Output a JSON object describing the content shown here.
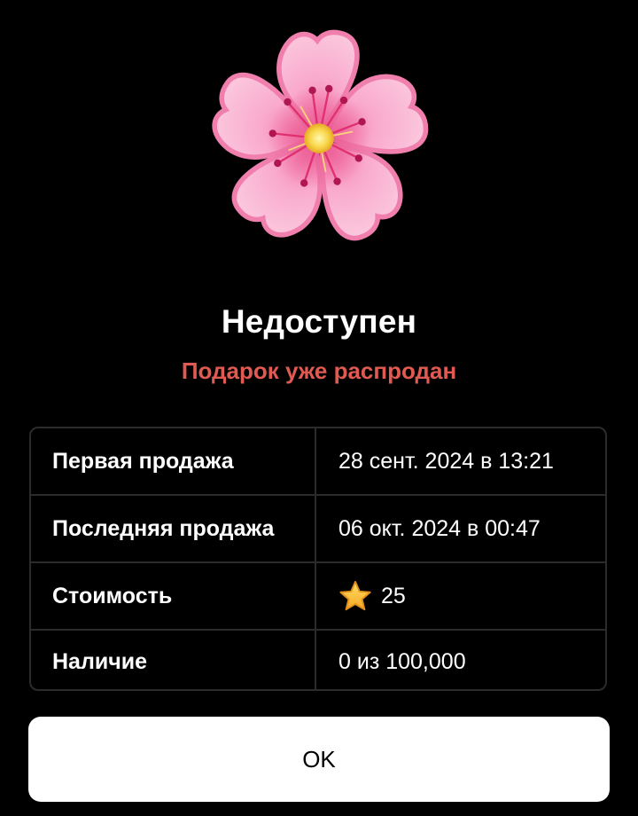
{
  "gift": {
    "icon": "cherry-blossom-icon",
    "title": "Недоступен",
    "subtitle": "Подарок уже распродан"
  },
  "details": [
    {
      "label": "Первая продажа",
      "value": "28 сент. 2024 в 13:21"
    },
    {
      "label": "Последняя продажа",
      "value": "06 окт. 2024 в 00:47"
    },
    {
      "label": "Стоимость",
      "value": "25",
      "icon": "star-icon"
    },
    {
      "label": "Наличие",
      "value": "0 из 100,000"
    }
  ],
  "actions": {
    "ok_label": "OK"
  },
  "colors": {
    "background": "#000000",
    "subtitle_red": "#e05a52",
    "border": "#2b2b2b",
    "button_bg": "#ffffff"
  }
}
